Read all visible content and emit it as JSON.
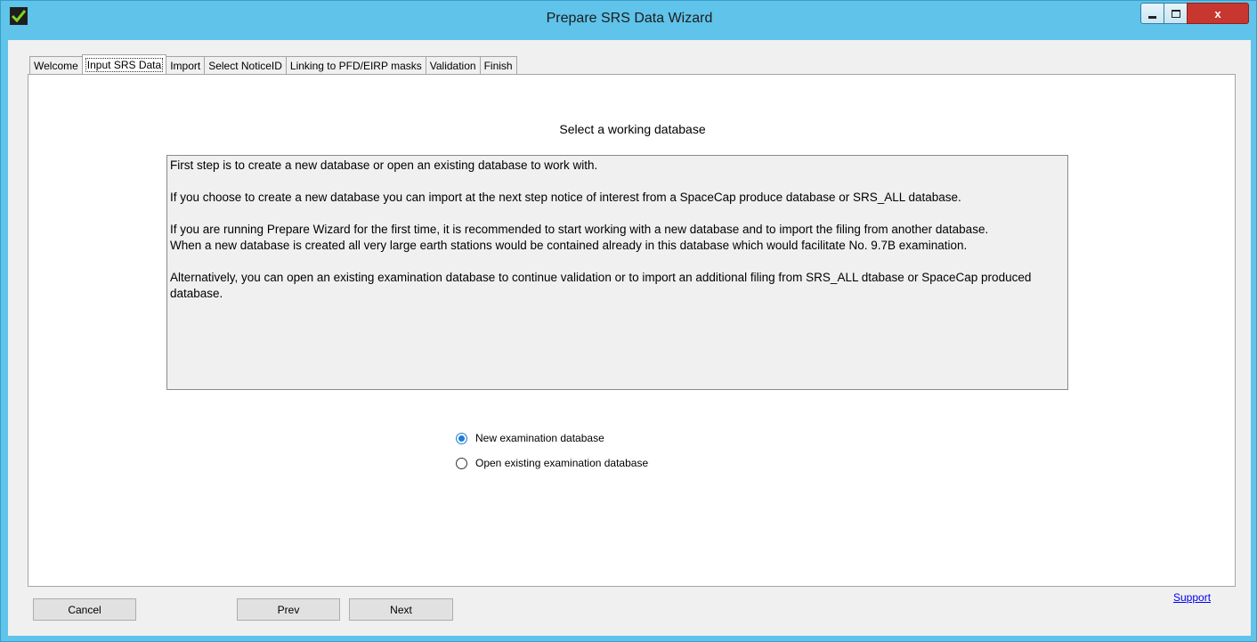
{
  "window": {
    "title": "Prepare SRS Data Wizard",
    "controls": {
      "minimize": "minimize",
      "maximize": "maximize",
      "close": "x"
    }
  },
  "tabs": [
    {
      "label": "Welcome"
    },
    {
      "label": "Input SRS Data",
      "active": true
    },
    {
      "label": "Import"
    },
    {
      "label": "Select NoticeID"
    },
    {
      "label": "Linking to PFD/EIRP masks"
    },
    {
      "label": "Validation"
    },
    {
      "label": "Finish"
    }
  ],
  "main": {
    "heading": "Select a working database",
    "info": [
      "First step is to create a new database or open an existing database  to work with.",
      "If you choose to create a new database you can import at the next step notice of interest from a SpaceCap produce database or SRS_ALL database.",
      "If you are running Prepare Wizard for the first time, it is recommended to start working with a new database and to import the filing from another database.",
      "When a new database is created all very large earth stations would be contained already in this database which would facilitate No. 9.7B examination.",
      "Alternatively, you can open an existing examination database to continue validation or to import an additional filing from SRS_ALL dtabase or SpaceCap produced database."
    ],
    "options": [
      {
        "label": "New examination database",
        "selected": true
      },
      {
        "label": "Open existing examination database",
        "selected": false
      }
    ]
  },
  "footer": {
    "cancel": "Cancel",
    "prev": "Prev",
    "next": "Next",
    "support": "Support"
  },
  "colors": {
    "titlebar": "#5fc3ea",
    "close_button": "#c7372f",
    "radio_accent": "#1f7cd6",
    "link": "#0000ee"
  }
}
